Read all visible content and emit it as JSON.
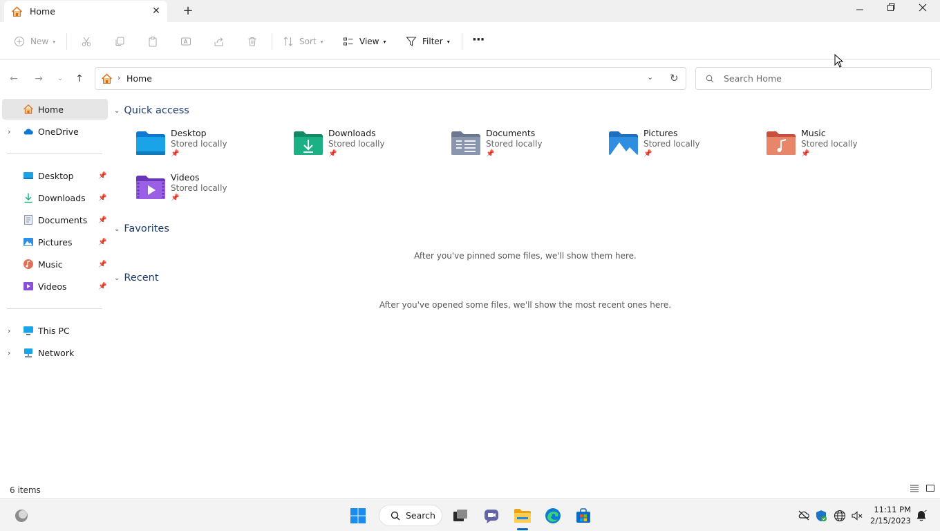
{
  "window": {
    "tab_title": "Home",
    "new_tab_symbol": "+",
    "controls": [
      "minimize",
      "maximize",
      "close"
    ]
  },
  "toolbar": {
    "new_label": "New",
    "sort_label": "Sort",
    "view_label": "View",
    "filter_label": "Filter",
    "more_symbol": "···",
    "icons": [
      "cut-icon",
      "copy-icon",
      "paste-icon",
      "rename-icon",
      "share-icon",
      "delete-icon"
    ]
  },
  "address": {
    "crumb": "Home",
    "search_placeholder": "Search Home"
  },
  "sidebar": {
    "home": "Home",
    "onedrive": "OneDrive",
    "pinned": [
      "Desktop",
      "Downloads",
      "Documents",
      "Pictures",
      "Music",
      "Videos"
    ],
    "this_pc": "This PC",
    "network": "Network"
  },
  "main": {
    "quick_access_title": "Quick access",
    "quick_access": [
      {
        "name": "Desktop",
        "status": "Stored locally",
        "color": "#1ba3e8"
      },
      {
        "name": "Downloads",
        "status": "Stored locally",
        "color": "#1bb184"
      },
      {
        "name": "Documents",
        "status": "Stored locally",
        "color": "#8a96ad"
      },
      {
        "name": "Pictures",
        "status": "Stored locally",
        "color": "#2f8ee0"
      },
      {
        "name": "Music",
        "status": "Stored locally",
        "color": "#e0705a"
      },
      {
        "name": "Videos",
        "status": "Stored locally",
        "color": "#8a4fd8"
      }
    ],
    "favorites_title": "Favorites",
    "favorites_empty": "After you've pinned some files, we'll show them here.",
    "recent_title": "Recent",
    "recent_empty": "After you've opened some files, we'll show the most recent ones here."
  },
  "status": {
    "items_count": "6 items"
  },
  "taskbar": {
    "search_label": "Search",
    "time": "11:11 PM",
    "date": "2/15/2023"
  }
}
